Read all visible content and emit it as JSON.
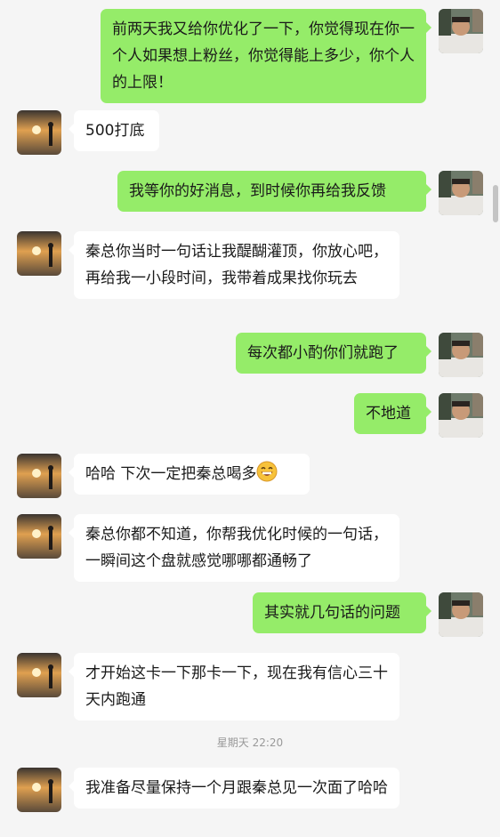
{
  "messages": [
    {
      "side": "right",
      "text": "前两天我又给你优化了一下，你觉得现在你一个人如果想上粉丝，你觉得能上多少，你个人的上限！"
    },
    {
      "side": "left",
      "text": "500打底"
    },
    {
      "side": "right",
      "text": "我等你的好消息，到时候你再给我反馈"
    },
    {
      "side": "left",
      "text": "秦总你当时一句话让我醍醐灌顶，你放心吧，再给我一小段时间，我带着成果找你玩去"
    },
    {
      "side": "right",
      "text": "每次都小酌你们就跑了"
    },
    {
      "side": "right",
      "text": "不地道"
    },
    {
      "side": "left",
      "text": "哈哈 下次一定把秦总喝多",
      "emoji": "grinning-emoji"
    },
    {
      "side": "left",
      "text": "秦总你都不知道，你帮我优化时候的一句话，一瞬间这个盘就感觉哪哪都通畅了"
    },
    {
      "side": "right",
      "text": "其实就几句话的问题"
    },
    {
      "side": "left",
      "text": "才开始这卡一下那卡一下，现在我有信心三十天内跑通"
    },
    {
      "side": "left",
      "text": "我准备尽量保持一个月跟秦总见一次面了哈哈"
    }
  ],
  "timestamp": "星期天 22:20",
  "colors": {
    "background": "#f5f5f5",
    "bubble_self": "#95ec69",
    "bubble_other": "#ffffff",
    "timestamp": "#999999"
  }
}
